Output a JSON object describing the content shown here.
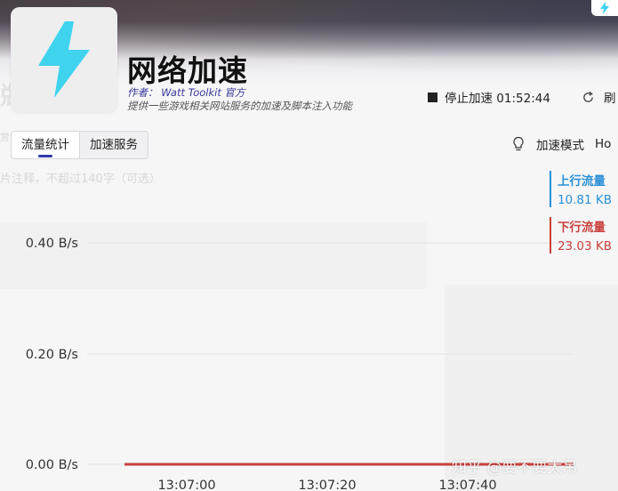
{
  "header": {
    "title": "网络加速",
    "author": "作者： Watt Toolkit 官方",
    "description": "提供一些游戏相关网站服务的加速及脚本注入功能",
    "stop_label": "停止加速 01:52:44",
    "refresh_label": "刷"
  },
  "tabs": [
    {
      "label": "流量统计",
      "active": true
    },
    {
      "label": "加速服务",
      "active": false
    }
  ],
  "mode": {
    "label": "加速模式",
    "value": "Ho"
  },
  "ghost": {
    "note": "片注释，不超过140字（可选）",
    "left_char": "敚",
    "left_small": "赏"
  },
  "colors": {
    "upload": "#2a8fd6",
    "download": "#c8413d",
    "accent": "#2f3aa8",
    "icon_fill": "#3fd3ee"
  },
  "legend": {
    "upload": {
      "name": "上行流量",
      "value": "10.81 KB"
    },
    "download": {
      "name": "下行流量",
      "value": "23.03 KB"
    }
  },
  "chart_data": {
    "type": "line",
    "x": [
      "13:07:00",
      "13:07:20",
      "13:07:40"
    ],
    "y_ticks": [
      "0.40 B/s",
      "0.20 B/s",
      "0.00 B/s"
    ],
    "ylim": [
      0,
      0.4
    ],
    "grid": true,
    "series": [
      {
        "name": "下行流量",
        "values": [
          0,
          0,
          0
        ]
      },
      {
        "name": "上行流量",
        "values": [
          0,
          0,
          0
        ]
      }
    ]
  },
  "watermark": "知乎 @要不要太吊"
}
